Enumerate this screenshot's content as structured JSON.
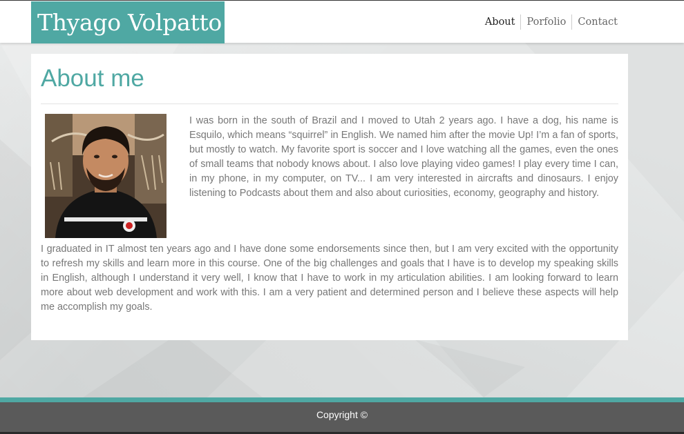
{
  "header": {
    "logo_text": "Thyago Volpatto",
    "nav": [
      {
        "label": "About"
      },
      {
        "label": "Porfolio"
      },
      {
        "label": "Contact"
      }
    ]
  },
  "main": {
    "title": "About me",
    "photo_icon": "portrait-photo",
    "paragraph1": "I was born in the south of Brazil and I moved to Utah 2 years ago. I have a dog, his name is Esquilo, which means “squirrel” in English. We named him after the movie Up! I’m a fan of sports, but mostly to watch. My favorite sport is soccer and I love watching all the games, even the ones of small teams that nobody knows about. I also love playing video games! I play every time I can, in my phone, in my computer, on TV... I am very interested in aircrafts and dinosaurs. I enjoy listening to Podcasts about them and also about curiosities, economy, geography and history.",
    "paragraph2": "I graduated in IT almost ten years ago and I have done some endorsements since then, but I am very excited with the opportunity to refresh my skills and learn more in this course. One of the big challenges and goals that I have is to develop my speaking skills in English, although I understand it very well, I know that I have to work in my articulation abilities. I am looking forward to learn more about web development and work with this. I am a very patient and determined person and I believe these aspects will help me accomplish my goals."
  },
  "footer": {
    "copyright": "Copyright ©"
  },
  "colors": {
    "accent": "#4fa8a3",
    "footer_bg": "#5a5a5a",
    "body_text": "#777777"
  }
}
